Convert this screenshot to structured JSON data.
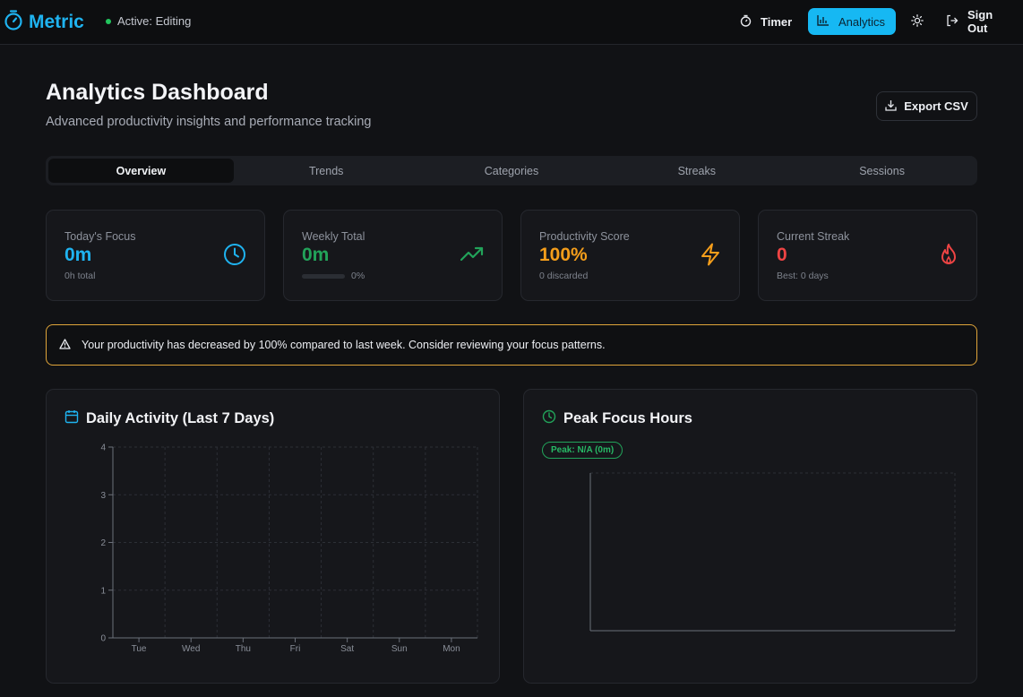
{
  "app": {
    "name": "Metric",
    "status": "Active: Editing"
  },
  "nav": {
    "timer": "Timer",
    "analytics": "Analytics",
    "sign_out": "Sign Out"
  },
  "header": {
    "title": "Analytics Dashboard",
    "subtitle": "Advanced productivity insights and performance tracking",
    "export_label": "Export CSV"
  },
  "tabs": [
    "Overview",
    "Trends",
    "Categories",
    "Streaks",
    "Sessions"
  ],
  "active_tab": "Overview",
  "stats": {
    "today": {
      "label": "Today's Focus",
      "value": "0m",
      "sub": "0h total",
      "color": "#1fb3f0",
      "icon": "clock-icon"
    },
    "weekly": {
      "label": "Weekly Total",
      "value": "0m",
      "progress_pct": "0%",
      "progress": 0,
      "color": "#22a35a",
      "icon": "trending-up-icon"
    },
    "productivity": {
      "label": "Productivity Score",
      "value": "100%",
      "sub": "0 discarded",
      "color": "#f59e1b",
      "icon": "lightning-icon"
    },
    "streak": {
      "label": "Current Streak",
      "value": "0",
      "sub": "Best: 0 days",
      "color": "#ef4444",
      "icon": "flame-icon"
    }
  },
  "alert": {
    "text": "Your productivity has decreased by 100% compared to last week. Consider reviewing your focus patterns.",
    "color": "#e0a53a",
    "icon": "warning-icon"
  },
  "daily_activity": {
    "title": "Daily Activity (Last 7 Days)",
    "icon": "calendar-icon"
  },
  "peak_hours": {
    "title": "Peak Focus Hours",
    "badge": "Peak: N/A (0m)",
    "icon": "clock-icon"
  },
  "chart_data": [
    {
      "type": "bar",
      "title": "Daily Activity (Last 7 Days)",
      "categories": [
        "Tue",
        "Wed",
        "Thu",
        "Fri",
        "Sat",
        "Sun",
        "Mon"
      ],
      "values": [
        0,
        0,
        0,
        0,
        0,
        0,
        0
      ],
      "y_ticks": [
        0,
        1,
        2,
        3,
        4
      ],
      "ylim": [
        0,
        4
      ],
      "grid": true
    },
    {
      "type": "bar",
      "title": "Peak Focus Hours",
      "categories": [],
      "values": [],
      "grid": true
    }
  ]
}
